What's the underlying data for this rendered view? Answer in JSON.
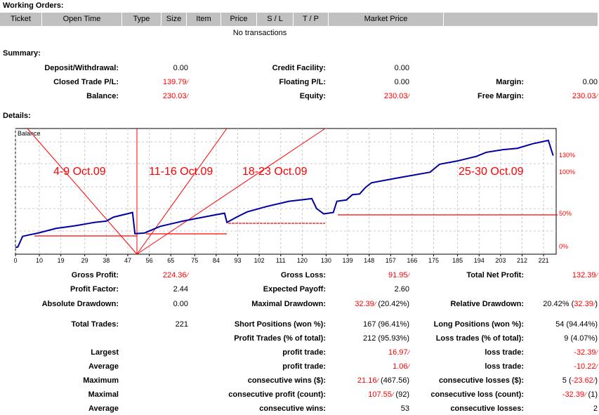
{
  "working_orders": {
    "title": "Working Orders:",
    "columns": [
      "Ticket",
      "Open Time",
      "Type",
      "Size",
      "Item",
      "Price",
      "S / L",
      "T / P",
      "Market Price",
      ""
    ],
    "empty_text": "No transactions"
  },
  "summary": {
    "title": "Summary:",
    "rows": [
      [
        {
          "label": "Deposit/Withdrawal:",
          "value": [
            {
              "t": "0.00"
            }
          ]
        },
        {
          "label": "Credit Facility:",
          "value": [
            {
              "t": "0.00"
            }
          ]
        },
        {
          "label": "",
          "value": []
        }
      ],
      [
        {
          "label": "Closed Trade P/L:",
          "value": [
            {
              "t": "139.79",
              "red": true
            }
          ]
        },
        {
          "label": "Floating P/L:",
          "value": [
            {
              "t": "0.00"
            }
          ]
        },
        {
          "label": "Margin:",
          "value": [
            {
              "t": "0.00"
            }
          ]
        }
      ],
      [
        {
          "label": "Balance:",
          "value": [
            {
              "t": "230.03",
              "red": true
            }
          ]
        },
        {
          "label": "Equity:",
          "value": [
            {
              "t": "230.03",
              "red": true
            }
          ]
        },
        {
          "label": "Free Margin:",
          "value": [
            {
              "t": "230.03",
              "red": true
            }
          ]
        }
      ]
    ]
  },
  "details": {
    "title": "Details:"
  },
  "chart_data": {
    "type": "line",
    "title": "Balance",
    "xlabel": "",
    "ylabel": "",
    "x_ticks": [
      0,
      10,
      19,
      29,
      38,
      47,
      56,
      65,
      75,
      84,
      93,
      102,
      111,
      120,
      130,
      139,
      148,
      157,
      166,
      175,
      185,
      194,
      203,
      212,
      221
    ],
    "xlim": [
      0,
      224
    ],
    "ylim": [
      80,
      270
    ],
    "grid": true,
    "series": [
      {
        "name": "Balance",
        "color": "#0000a0",
        "x": [
          0,
          1,
          3,
          5.5,
          9.5,
          17,
          25,
          33,
          38,
          41,
          49,
          50,
          54,
          60.5,
          70,
          83,
          87.5,
          88.5,
          92.5,
          97,
          105,
          114.5,
          124,
          126,
          129,
          133,
          134.5,
          138.5,
          141,
          144,
          146.5,
          149,
          161,
          173.5,
          177.5,
          185,
          193,
          197,
          204,
          210,
          216.5,
          223,
          225
        ],
        "y": [
          90,
          91,
          107,
          109,
          112,
          119,
          123,
          128,
          130,
          136,
          143,
          111,
          112,
          122,
          130,
          139,
          142,
          128,
          136,
          144,
          152,
          160,
          164,
          149,
          141,
          143,
          160,
          162,
          170,
          171,
          181,
          188,
          196,
          204,
          216,
          221,
          228,
          234,
          238,
          240,
          247,
          252,
          229
        ]
      }
    ],
    "annotations": [
      "4-9 Oct.09",
      "11-16 Oct.09",
      "18-23 Oct.09",
      "25-30 Oct.09"
    ],
    "right_labels": [
      "130%",
      "100%",
      "50%",
      "0%"
    ]
  },
  "stats": {
    "rows": [
      [
        {
          "label": "Gross Profit:",
          "value": [
            {
              "t": "224.36",
              "red": true
            }
          ]
        },
        {
          "label": "Gross Loss:",
          "value": [
            {
              "t": "91.95",
              "red": true
            }
          ]
        },
        {
          "label": "Total Net Profit:",
          "value": [
            {
              "t": "132.39",
              "red": true
            }
          ]
        }
      ],
      [
        {
          "label": "Profit Factor:",
          "value": [
            {
              "t": "2.44"
            }
          ]
        },
        {
          "label": "Expected Payoff:",
          "value": [
            {
              "t": "2.60"
            }
          ]
        },
        {
          "label": "",
          "value": []
        }
      ],
      [
        {
          "label": "Absolute Drawdown:",
          "value": [
            {
              "t": "0.00"
            }
          ]
        },
        {
          "label": "Maximal Drawdown:",
          "value": [
            {
              "t": "32.39",
              "red": true
            },
            {
              "t": " (20.42%)"
            }
          ]
        },
        {
          "label": "Relative Drawdown:",
          "value": [
            {
              "t": "20.42% ("
            },
            {
              "t": "32.39",
              "red": true
            },
            {
              "t": ")"
            }
          ]
        }
      ],
      [
        {
          "label": "Total Trades:",
          "value": [
            {
              "t": "221"
            }
          ]
        },
        {
          "label": "Short Positions (won %):",
          "value": [
            {
              "t": "167 (96.41%)"
            }
          ]
        },
        {
          "label": "Long Positions (won %):",
          "value": [
            {
              "t": "54 (94.44%)"
            }
          ]
        }
      ],
      [
        {
          "label": "",
          "value": []
        },
        {
          "label": "Profit Trades (% of total):",
          "value": [
            {
              "t": "212 (95.93%)"
            }
          ]
        },
        {
          "label": "Loss trades (% of total):",
          "value": [
            {
              "t": "9 (4.07%)"
            }
          ]
        }
      ],
      [
        {
          "label": "Largest",
          "value": []
        },
        {
          "label": "profit trade:",
          "value": [
            {
              "t": "16.97",
              "red": true
            }
          ]
        },
        {
          "label": "loss trade:",
          "value": [
            {
              "t": "-32.39",
              "red": true
            }
          ]
        }
      ],
      [
        {
          "label": "Average",
          "value": []
        },
        {
          "label": "profit trade:",
          "value": [
            {
              "t": "1.06",
              "red": true
            }
          ]
        },
        {
          "label": "loss trade:",
          "value": [
            {
              "t": "-10.22",
              "red": true
            }
          ]
        }
      ],
      [
        {
          "label": "Maximum",
          "value": []
        },
        {
          "label": "consecutive wins ($):",
          "value": [
            {
              "t": "21.16",
              "red": true
            },
            {
              "t": " (467.56)"
            }
          ]
        },
        {
          "label": "consecutive losses ($):",
          "value": [
            {
              "t": "5 ("
            },
            {
              "t": "-23.62",
              "red": true
            },
            {
              "t": ")"
            }
          ]
        }
      ],
      [
        {
          "label": "Maximal",
          "value": []
        },
        {
          "label": "consecutive profit (count):",
          "value": [
            {
              "t": "107.55",
              "red": true
            },
            {
              "t": " (92)"
            }
          ]
        },
        {
          "label": "consecutive loss (count):",
          "value": [
            {
              "t": "-32.39",
              "red": true
            },
            {
              "t": " (1)"
            }
          ]
        }
      ],
      [
        {
          "label": "Average",
          "value": []
        },
        {
          "label": "consecutive wins:",
          "value": [
            {
              "t": "53"
            }
          ]
        },
        {
          "label": "consecutive losses:",
          "value": [
            {
              "t": "2"
            }
          ]
        }
      ]
    ]
  }
}
